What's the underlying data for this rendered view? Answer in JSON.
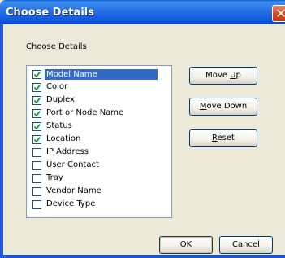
{
  "window": {
    "title": "Choose Details",
    "close_glyph": "✕"
  },
  "group": {
    "label_prefix": "",
    "label_accel": "C",
    "label_rest": "hoose Details"
  },
  "items": [
    {
      "label": "Model Name",
      "checked": true,
      "selected": true
    },
    {
      "label": "Color",
      "checked": true,
      "selected": false
    },
    {
      "label": "Duplex",
      "checked": true,
      "selected": false
    },
    {
      "label": "Port or Node Name",
      "checked": true,
      "selected": false
    },
    {
      "label": "Status",
      "checked": true,
      "selected": false
    },
    {
      "label": "Location",
      "checked": true,
      "selected": false
    },
    {
      "label": "IP Address",
      "checked": false,
      "selected": false
    },
    {
      "label": "User Contact",
      "checked": false,
      "selected": false
    },
    {
      "label": "Tray",
      "checked": false,
      "selected": false
    },
    {
      "label": "Vendor Name",
      "checked": false,
      "selected": false
    },
    {
      "label": "Device Type",
      "checked": false,
      "selected": false
    }
  ],
  "buttons": {
    "move_up": {
      "pre": "Move ",
      "accel": "U",
      "post": "p"
    },
    "move_down": {
      "pre": "",
      "accel": "M",
      "post": "ove Down"
    },
    "reset": {
      "pre": "",
      "accel": "R",
      "post": "eset"
    },
    "ok": {
      "pre": "",
      "accel": "",
      "post": "OK"
    },
    "cancel": {
      "pre": "",
      "accel": "",
      "post": "Cancel"
    }
  },
  "colors": {
    "title_bar": "#0a5fd6",
    "selection": "#316ac5",
    "check": "#21a121",
    "dialog_bg": "#ece9d8"
  }
}
